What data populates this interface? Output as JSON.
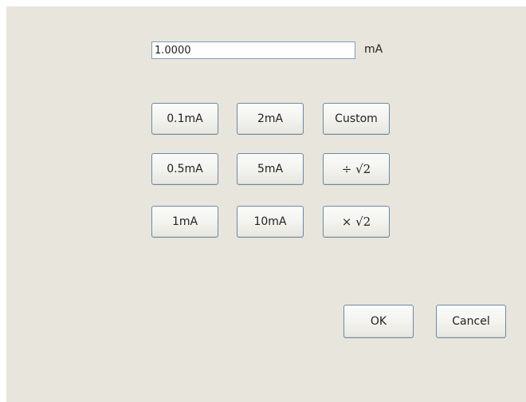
{
  "value_input": {
    "value": "1.0000",
    "unit": "mA"
  },
  "keypad": [
    {
      "label": "0.1mA",
      "name": "preset-0-1ma-button"
    },
    {
      "label": "2mA",
      "name": "preset-2ma-button"
    },
    {
      "label": "Custom",
      "name": "custom-button"
    },
    {
      "label": "0.5mA",
      "name": "preset-0-5ma-button"
    },
    {
      "label": "5mA",
      "name": "preset-5ma-button"
    },
    {
      "label": "÷ √2",
      "name": "divide-sqrt2-button"
    },
    {
      "label": "1mA",
      "name": "preset-1ma-button"
    },
    {
      "label": "10mA",
      "name": "preset-10ma-button"
    },
    {
      "label": "× √2",
      "name": "multiply-sqrt2-button"
    }
  ],
  "actions": {
    "ok": "OK",
    "cancel": "Cancel"
  }
}
